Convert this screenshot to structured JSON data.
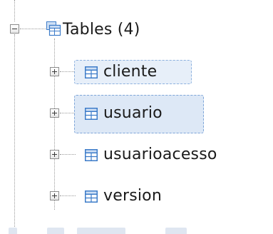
{
  "tree": {
    "tables_node": {
      "label": "Tables (4)",
      "icon": "table-folder-icon",
      "expanded": true
    },
    "tables": [
      {
        "name": "cliente",
        "icon": "table-icon",
        "state": "focused"
      },
      {
        "name": "usuario",
        "icon": "table-icon",
        "state": "selected"
      },
      {
        "name": "usuarioacesso",
        "icon": "table-icon",
        "state": "normal"
      },
      {
        "name": "version",
        "icon": "table-icon",
        "state": "normal"
      }
    ]
  },
  "colors": {
    "selection_bg": "#dde8f6",
    "selection_border": "#7ea5d8",
    "table_icon_stroke": "#3d7cc9",
    "table_icon_header": "#cfe0f5"
  }
}
